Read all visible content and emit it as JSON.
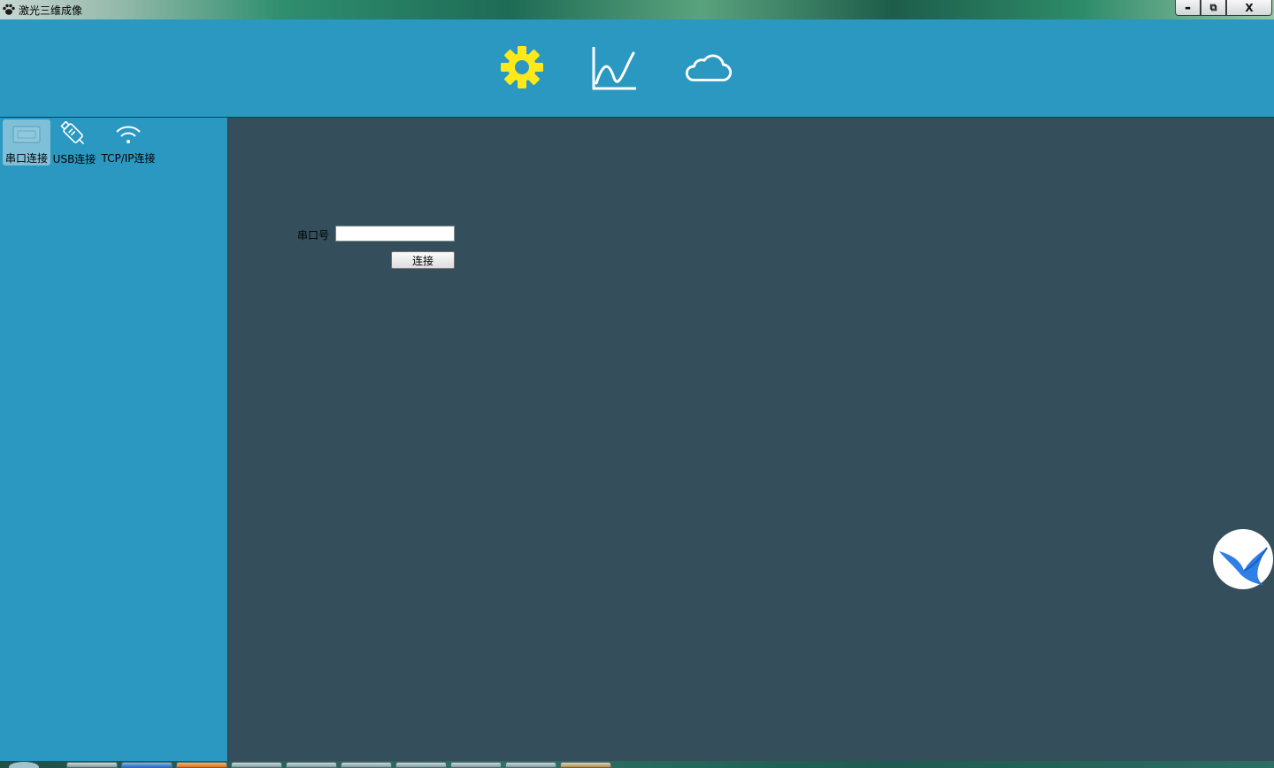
{
  "window": {
    "title": "激光三维成像",
    "controls": {
      "minimize": "▬",
      "restore": "⧉",
      "close": "X"
    }
  },
  "toolbar": {
    "items": [
      {
        "name": "settings",
        "icon": "gear-icon",
        "color": "#ffe81a",
        "active": true
      },
      {
        "name": "chart",
        "icon": "line-chart-icon",
        "color": "#ffffff",
        "active": false
      },
      {
        "name": "cloud",
        "icon": "cloud-icon",
        "color": "#ffffff",
        "active": false
      }
    ]
  },
  "sidebar": {
    "items": [
      {
        "label": "串口连接",
        "icon": "serial-port-icon",
        "selected": true
      },
      {
        "label": "USB连接",
        "icon": "usb-icon",
        "selected": false
      },
      {
        "label": "TCP/IP连接",
        "icon": "wifi-icon",
        "selected": false
      }
    ]
  },
  "main": {
    "port_label": "串口号",
    "port_value": "",
    "connect_label": "连接"
  },
  "colors": {
    "toolbar_bg": "#2a98c0",
    "sidebar_bg": "#2a98c0",
    "main_bg": "#344e5c",
    "accent": "#ffe81a"
  }
}
